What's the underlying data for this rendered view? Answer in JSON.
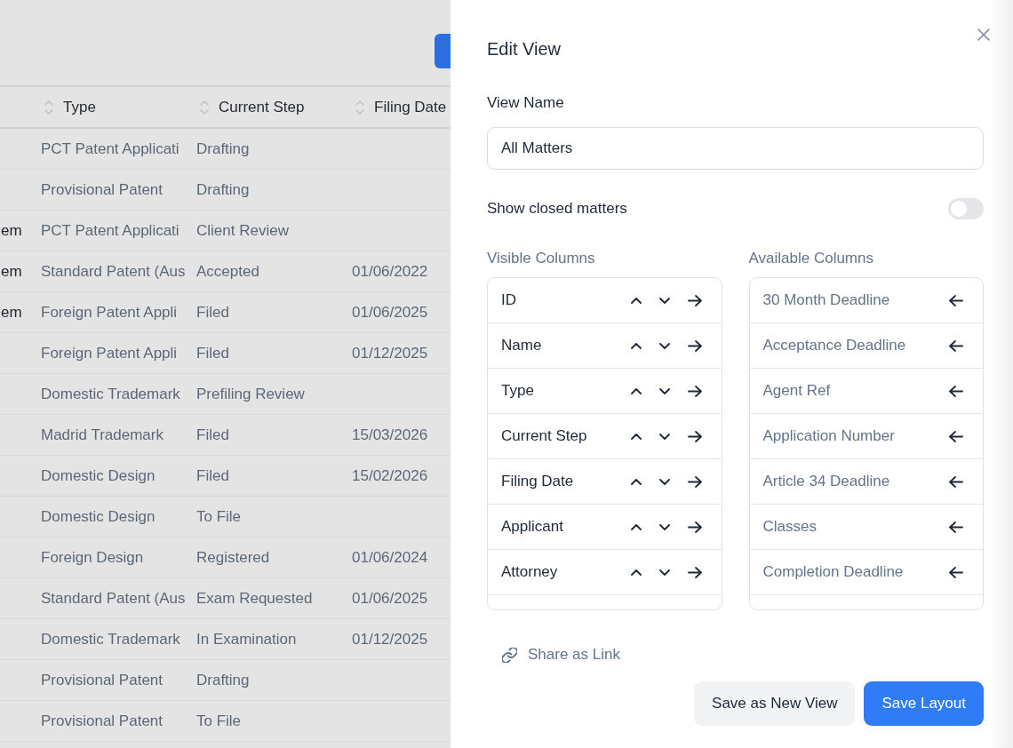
{
  "table": {
    "columns": [
      {
        "label": "Type"
      },
      {
        "label": "Current Step"
      },
      {
        "label": "Filing Date"
      }
    ],
    "rows": [
      {
        "type": "PCT Patent Applicati",
        "current_step": "Drafting"
      },
      {
        "type": "Provisional Patent",
        "current_step": "Drafting"
      },
      {
        "column_1": "em",
        "type": "PCT Patent Applicati",
        "current_step": "Client Review"
      },
      {
        "column_1": "em",
        "type": "Standard Patent (Aus",
        "current_step": "Accepted",
        "filing_date": "01/06/2022"
      },
      {
        "column_1": "em",
        "type": "Foreign Patent Appli",
        "current_step": "Filed",
        "filing_date": "01/06/2025"
      },
      {
        "type": "Foreign Patent Appli",
        "current_step": "Filed",
        "filing_date": "01/12/2025"
      },
      {
        "type": "Domestic Trademark",
        "current_step": "Prefiling Review"
      },
      {
        "type": "Madrid Trademark",
        "current_step": "Filed",
        "filing_date": "15/03/2026"
      },
      {
        "type": "Domestic Design",
        "current_step": "Filed",
        "filing_date": "15/02/2026"
      },
      {
        "type": "Domestic Design",
        "current_step": "To File"
      },
      {
        "type": "Foreign Design",
        "current_step": "Registered",
        "filing_date": "01/06/2024"
      },
      {
        "type": "Standard Patent (Aus",
        "current_step": "Exam Requested",
        "filing_date": "01/06/2025"
      },
      {
        "type": "Domestic Trademark",
        "current_step": "In Examination",
        "filing_date": "01/12/2025"
      },
      {
        "type": "Provisional Patent",
        "current_step": "Drafting"
      },
      {
        "type": "Provisional Patent",
        "current_step": "To File"
      }
    ]
  },
  "edit_view_panel": {
    "title": "Edit View",
    "view_name": {
      "label": "View Name",
      "value": "All Matters"
    },
    "show_closed_matters": {
      "label": "Show closed matters",
      "on": false
    },
    "visible_columns": {
      "label": "Visible Columns",
      "items": [
        "ID",
        "Name",
        "Type",
        "Current Step",
        "Filing Date",
        "Applicant",
        "Attorney"
      ]
    },
    "available_columns": {
      "label": "Available Columns",
      "items": [
        "30 Month Deadline",
        "Acceptance Deadline",
        "Agent Ref",
        "Application Number",
        "Article 34 Deadline",
        "Classes",
        "Completion Deadline"
      ]
    },
    "share_link": {
      "label": "Share as Link"
    },
    "buttons": [
      {
        "label": "Save as New View",
        "kind": "secondary"
      },
      {
        "label": "Save Layout",
        "kind": "primary"
      }
    ]
  }
}
